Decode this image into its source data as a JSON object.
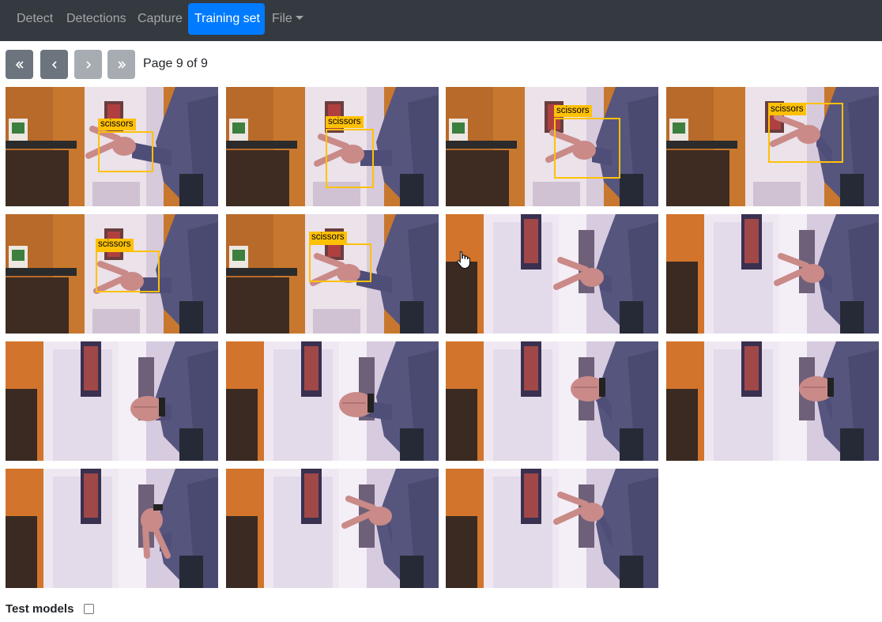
{
  "nav": {
    "detect": "Detect",
    "detections": "Detections",
    "capture": "Capture",
    "training_set": "Training set",
    "file": "File"
  },
  "pager": {
    "text": "Page 9 of 9",
    "first_icon": "double-chevron-left-icon",
    "prev_icon": "chevron-left-icon",
    "next_icon": "chevron-right-icon",
    "last_icon": "double-chevron-right-icon"
  },
  "thumbs": [
    {
      "label": "scissors"
    },
    {
      "label": "scissors"
    },
    {
      "label": "scissors"
    },
    {
      "label": "scissors"
    },
    {
      "label": "scissors"
    },
    {
      "label": "scissors"
    },
    {
      "label": ""
    },
    {
      "label": ""
    },
    {
      "label": ""
    },
    {
      "label": ""
    },
    {
      "label": ""
    },
    {
      "label": ""
    },
    {
      "label": ""
    },
    {
      "label": ""
    },
    {
      "label": ""
    }
  ],
  "footer": {
    "test_models": "Test models"
  },
  "colors": {
    "navbar": "#343a40",
    "active": "#007bff",
    "bbox": "#ffc107"
  }
}
